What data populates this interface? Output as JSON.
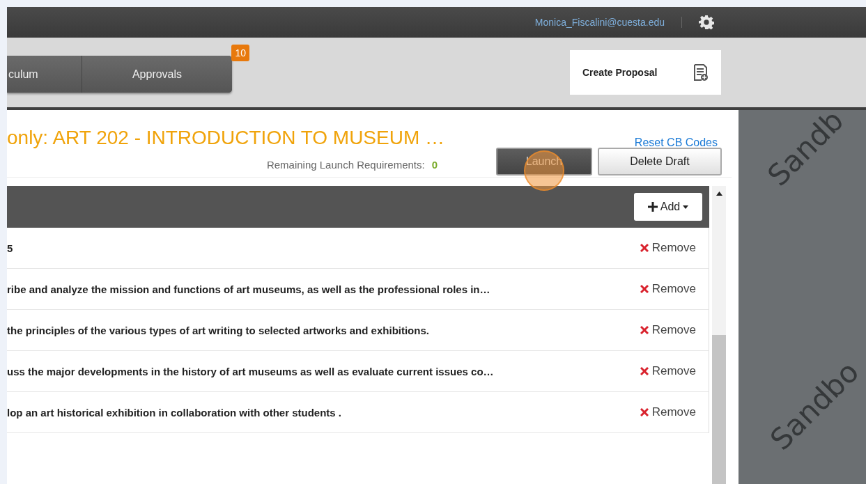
{
  "top_bar": {
    "user_email": "Monica_Fiscalini@cuesta.edu"
  },
  "nav_tabs": [
    {
      "label": "culum",
      "selected": false
    },
    {
      "label": "Approvals",
      "selected": false,
      "badge": "10"
    }
  ],
  "create_proposal": {
    "label": "Create Proposal"
  },
  "proposal": {
    "title": "only: ART 202 - INTRODUCTION TO MUSEUM …",
    "reset_link": "Reset CB Codes",
    "requirements_label": "Remaining Launch Requirements:",
    "requirements_count": "0",
    "launch_button": "Launch",
    "delete_button": "Delete Draft"
  },
  "outcomes": {
    "add_button": "Add",
    "rows": [
      {
        "text": "5",
        "action": "Remove"
      },
      {
        "text": "ribe and analyze the mission and functions of art museums, as well as the professional roles in…",
        "action": "Remove"
      },
      {
        "text": "the principles of the various types of art writing to selected artworks and exhibitions.",
        "action": "Remove"
      },
      {
        "text": "uss the major developments in the history of art museums as well as evaluate current issues co…",
        "action": "Remove"
      },
      {
        "text": "lop an art historical exhibition in collaboration with other students .",
        "action": "Remove"
      }
    ]
  },
  "background_marks": [
    "Sandb",
    "Sandbo"
  ]
}
